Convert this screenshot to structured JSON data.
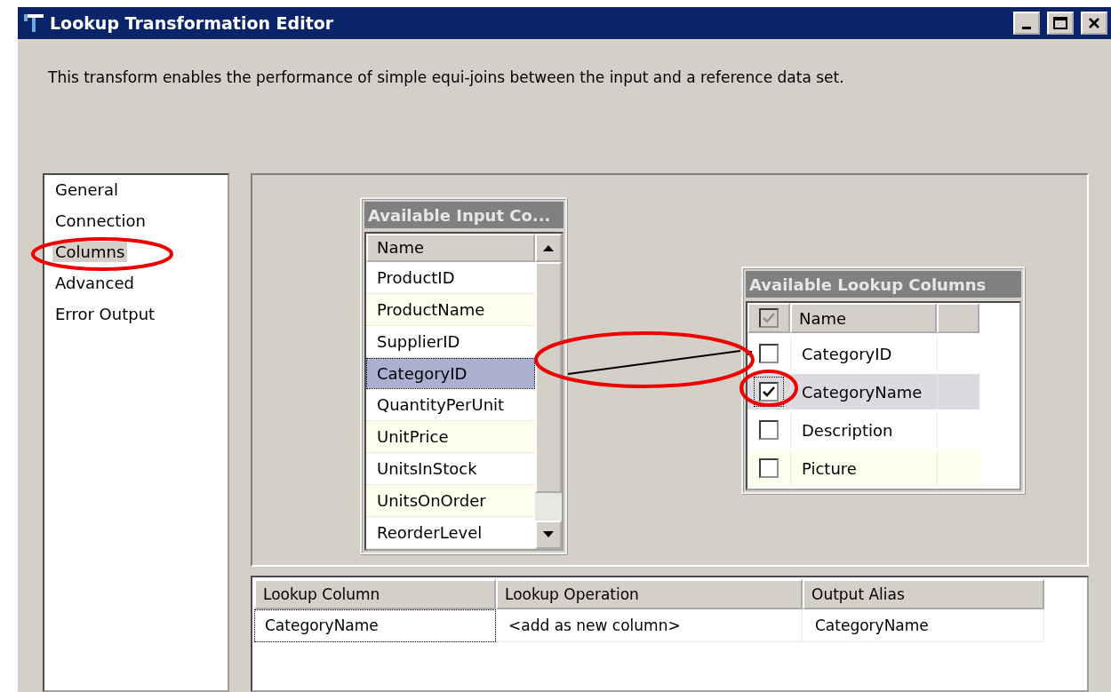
{
  "window": {
    "title": "Lookup Transformation Editor"
  },
  "description": "This transform enables the performance of simple equi-joins between the input and a reference data set.",
  "nav": [
    {
      "label": "General",
      "selected": false
    },
    {
      "label": "Connection",
      "selected": false
    },
    {
      "label": "Columns",
      "selected": true
    },
    {
      "label": "Advanced",
      "selected": false
    },
    {
      "label": "Error Output",
      "selected": false
    }
  ],
  "input_table": {
    "title": "Available Input Co...",
    "header": "Name",
    "rows": [
      {
        "name": "ProductID",
        "selected": false
      },
      {
        "name": "ProductName",
        "selected": false
      },
      {
        "name": "SupplierID",
        "selected": false
      },
      {
        "name": "CategoryID",
        "selected": true
      },
      {
        "name": "QuantityPerUnit",
        "selected": false
      },
      {
        "name": "UnitPrice",
        "selected": false
      },
      {
        "name": "UnitsInStock",
        "selected": false
      },
      {
        "name": "UnitsOnOrder",
        "selected": false
      },
      {
        "name": "ReorderLevel",
        "selected": false
      }
    ]
  },
  "lookup_table": {
    "title": "Available Lookup Columns",
    "header": "Name",
    "header_checked": true,
    "rows": [
      {
        "name": "CategoryID",
        "checked": false,
        "selected": false,
        "mapped": true
      },
      {
        "name": "CategoryName",
        "checked": true,
        "selected": true,
        "mapped": false
      },
      {
        "name": "Description",
        "checked": false,
        "selected": false,
        "mapped": false
      },
      {
        "name": "Picture",
        "checked": false,
        "selected": false,
        "mapped": false
      }
    ]
  },
  "output_grid": {
    "columns": [
      "Lookup Column",
      "Lookup Operation",
      "Output Alias"
    ],
    "rows": [
      [
        "CategoryName",
        "<add as new column>",
        "CategoryName"
      ]
    ]
  },
  "annotation_marks": [
    {
      "kind": "ellipse"
    },
    {
      "kind": "ellipse"
    },
    {
      "kind": "ellipse"
    }
  ]
}
